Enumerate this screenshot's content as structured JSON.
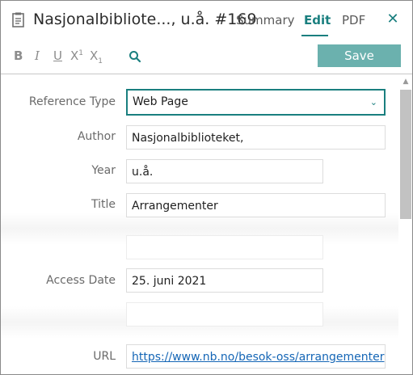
{
  "header": {
    "title": "Nasjonalbibliote..., u.å. #169",
    "tabs": [
      {
        "label": "Summary",
        "active": false
      },
      {
        "label": "Edit",
        "active": true
      },
      {
        "label": "PDF",
        "active": false
      }
    ]
  },
  "toolbar": {
    "bold": "B",
    "italic": "I",
    "underline": "U",
    "superscript": "X",
    "superscript_mark": "1",
    "subscript": "X",
    "subscript_mark": "1",
    "save_label": "Save"
  },
  "form": {
    "reference_type": {
      "label": "Reference Type",
      "value": "Web Page"
    },
    "author": {
      "label": "Author",
      "value": "Nasjonalbiblioteket,"
    },
    "year": {
      "label": "Year",
      "value": "u.å."
    },
    "title": {
      "label": "Title",
      "value": "Arrangementer"
    },
    "access_date": {
      "label": "Access Date",
      "value": "25. juni 2021"
    },
    "url": {
      "label": "URL",
      "value": "https://www.nb.no/besok-oss/arrangementer"
    }
  },
  "colors": {
    "accent": "#1a7f7f",
    "save_button": "#6bb1ae",
    "link": "#1566b6"
  },
  "icons": {
    "document": "document-icon",
    "close": "close-icon",
    "search": "search-icon",
    "dropdown": "chevron-down-icon",
    "scroll_up": "scroll-up-arrow-icon"
  }
}
